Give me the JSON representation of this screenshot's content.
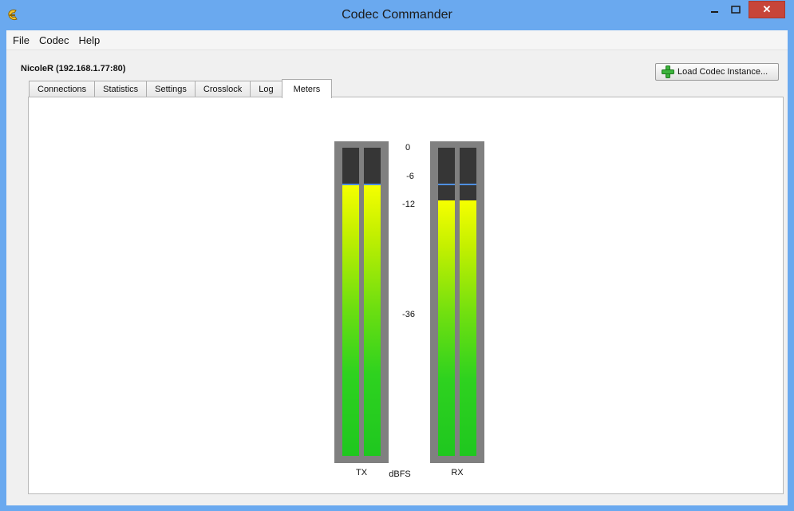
{
  "window": {
    "title": "Codec Commander",
    "close_glyph": "✕"
  },
  "menu": [
    "File",
    "Codec",
    "Help"
  ],
  "instance_label": "NicoleR (192.168.1.77:80)",
  "load_button_label": "Load Codec Instance...",
  "tabs": [
    "Connections",
    "Statistics",
    "Settings",
    "Crosslock",
    "Log",
    "Meters"
  ],
  "active_tab": "Meters",
  "meters": {
    "scale_labels": [
      "0",
      "-6",
      "-12",
      "-36"
    ],
    "unit_label": "dBFS",
    "tx": {
      "label": "TX",
      "channels": [
        {
          "level": 0.88,
          "peak": 0.88
        },
        {
          "level": 0.88,
          "peak": 0.88
        }
      ]
    },
    "rx": {
      "label": "RX",
      "channels": [
        {
          "level": 0.83,
          "peak": 0.88
        },
        {
          "level": 0.83,
          "peak": 0.88
        }
      ]
    }
  },
  "colors": {
    "title_bar": "#6aa9ef",
    "close_button": "#c74539",
    "meter_frame": "#808080",
    "meter_background": "#363636",
    "peak_marker": "#4f8fe0"
  }
}
